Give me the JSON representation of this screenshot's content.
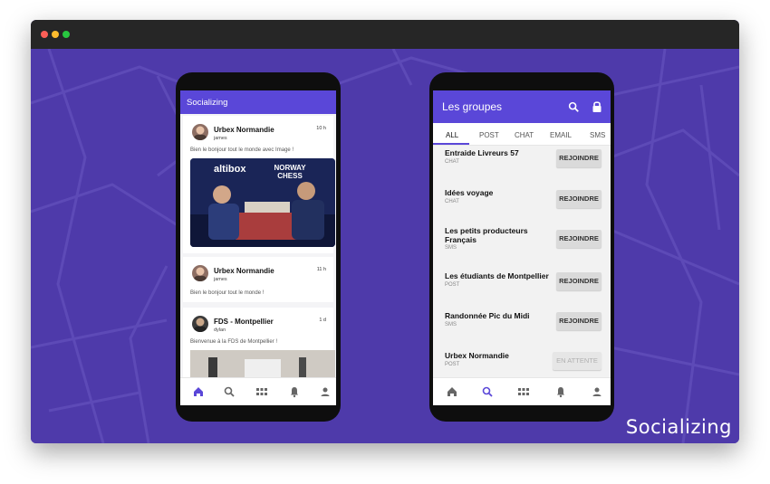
{
  "brand": "Socializing",
  "window": {
    "dots": [
      "#fe5f57",
      "#febc2e",
      "#28c840"
    ]
  },
  "feed": {
    "title": "Socializing",
    "posts": [
      {
        "name": "Urbex Normandie",
        "user": "james",
        "time": "10 h",
        "message": "Bien le bonjour tout le monde avec Image !",
        "image_text": "NORWAY CHESS",
        "image_brand": "altibox"
      },
      {
        "name": "Urbex Normandie",
        "user": "james",
        "time": "11 h",
        "message": "Bien le bonjour tout le monde !"
      },
      {
        "name": "FDS - Montpellier",
        "user": "dylan",
        "time": "1 d",
        "message": "Bienvenue à la FDS de Montpellier !"
      }
    ],
    "nav_icons": [
      "home-icon",
      "search-icon",
      "apps-icon",
      "bell-icon",
      "person-icon"
    ],
    "nav_active": "home-icon"
  },
  "groups": {
    "title": "Les groupes",
    "tabs": [
      "ALL",
      "POST",
      "CHAT",
      "EMAIL",
      "SMS"
    ],
    "active_tab": "ALL",
    "items": [
      {
        "name": "Entraide Livreurs 57",
        "type": "CHAT",
        "action": "REJOINDRE"
      },
      {
        "name": "Idées voyage",
        "type": "CHAT",
        "action": "REJOINDRE"
      },
      {
        "name": "Les petits producteurs Français",
        "type": "SMS",
        "action": "REJOINDRE"
      },
      {
        "name": "Les étudiants de Montpellier",
        "type": "POST",
        "action": "REJOINDRE"
      },
      {
        "name": "Randonnée Pic du Midi",
        "type": "SMS",
        "action": "REJOINDRE"
      },
      {
        "name": "Urbex Normandie",
        "type": "POST",
        "action": "EN ATTENTE"
      }
    ],
    "nav_icons": [
      "home-icon",
      "search-icon",
      "apps-icon",
      "bell-icon",
      "person-icon"
    ],
    "nav_active": "search-icon"
  },
  "colors": {
    "accent": "#5a47d8",
    "background": "#4e3aaa",
    "tab_indicator": "#5a47d8"
  }
}
